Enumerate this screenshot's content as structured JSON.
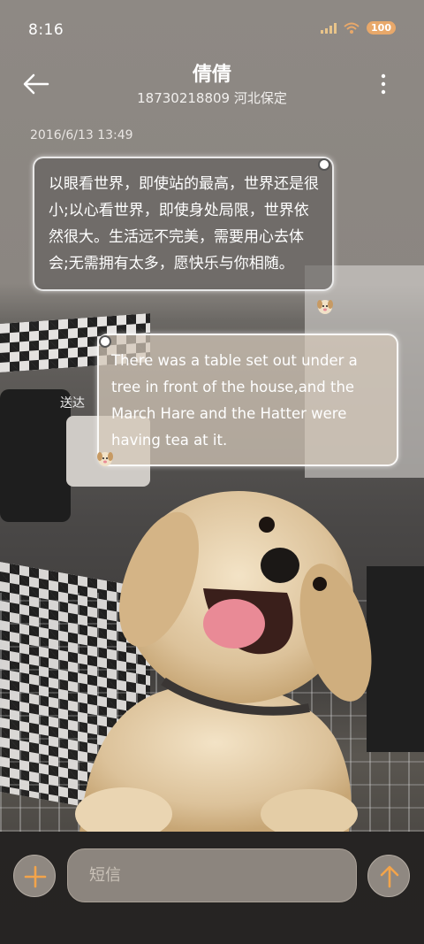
{
  "status_bar": {
    "time": "8:16",
    "battery": "100",
    "icons": [
      "signal-icon",
      "wifi-icon",
      "battery-icon"
    ]
  },
  "header": {
    "title": "倩倩",
    "subtitle": "18730218809 河北保定",
    "back_icon": "back-arrow-icon",
    "more_icon": "more-vertical-icon"
  },
  "conversation": {
    "timestamp": "2016/6/13 13:49",
    "messages": [
      {
        "direction": "incoming",
        "text": "以眼看世界，即使站的最高，世界还是很小;以心看世界，即使身处局限，世界依然很大。生活远不完美，需要用心去体会;无需拥有太多，愿快乐与你相随。"
      },
      {
        "direction": "outgoing",
        "text": "There was a table set out under a tree in front of the house,and the March Hare and the Hatter were having tea at it.",
        "status": "送达"
      }
    ]
  },
  "input_bar": {
    "placeholder": "短信",
    "add_icon": "plus-icon",
    "send_icon": "arrow-up-icon"
  },
  "colors": {
    "accent": "#e8a86a",
    "incoming_bubble": "#5f5c5a",
    "outgoing_bubble": "#d5c9ba",
    "input_bar": "#262423"
  }
}
